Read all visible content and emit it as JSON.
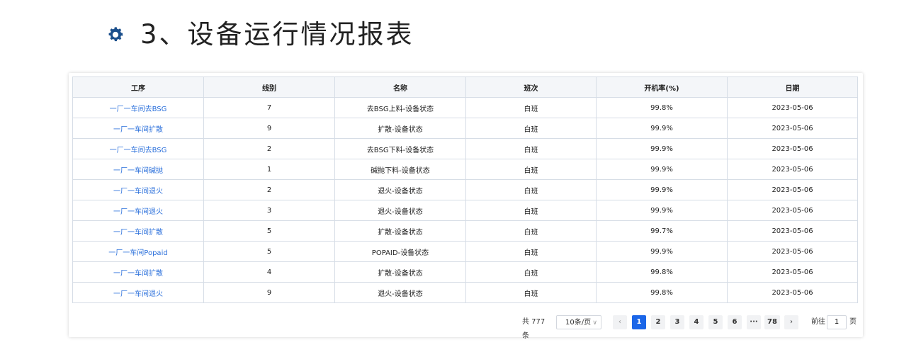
{
  "heading": {
    "title": "3、设备运行情况报表",
    "icon": "gear-icon",
    "icon_color": "#1b4f8c"
  },
  "table": {
    "headers": [
      "工序",
      "线别",
      "名称",
      "班次",
      "开机率(%)",
      "日期"
    ],
    "rows": [
      [
        "一厂一车间去BSG",
        "7",
        "去BSG上料-设备状态",
        "白班",
        "99.8%",
        "2023-05-06"
      ],
      [
        "一厂一车间扩散",
        "9",
        "扩散-设备状态",
        "白班",
        "99.9%",
        "2023-05-06"
      ],
      [
        "一厂一车间去BSG",
        "2",
        "去BSG下料-设备状态",
        "白班",
        "99.9%",
        "2023-05-06"
      ],
      [
        "一厂一车间碱抛",
        "1",
        "碱抛下料-设备状态",
        "白班",
        "99.9%",
        "2023-05-06"
      ],
      [
        "一厂一车间退火",
        "2",
        "退火-设备状态",
        "白班",
        "99.9%",
        "2023-05-06"
      ],
      [
        "一厂一车间退火",
        "3",
        "退火-设备状态",
        "白班",
        "99.9%",
        "2023-05-06"
      ],
      [
        "一厂一车间扩散",
        "5",
        "扩散-设备状态",
        "白班",
        "99.7%",
        "2023-05-06"
      ],
      [
        "一厂一车间Popaid",
        "5",
        "POPAID-设备状态",
        "白班",
        "99.9%",
        "2023-05-06"
      ],
      [
        "一厂一车间扩散",
        "4",
        "扩散-设备状态",
        "白班",
        "99.8%",
        "2023-05-06"
      ],
      [
        "一厂一车间退火",
        "9",
        "退火-设备状态",
        "白班",
        "99.8%",
        "2023-05-06"
      ]
    ]
  },
  "pagination": {
    "total": "共 777 条",
    "page_size": "10条/页",
    "prev_icon": "chevron-left-icon",
    "next_icon": "chevron-right-icon",
    "pages": [
      "1",
      "2",
      "3",
      "4",
      "5",
      "6",
      "···",
      "78"
    ],
    "current": "1",
    "goto_label": "前往",
    "goto_value": "1",
    "page_word": "页"
  },
  "colors": {
    "link": "#2a6fdb",
    "active_page": "#1b66e8",
    "header_bg": "#f4f6f9"
  }
}
